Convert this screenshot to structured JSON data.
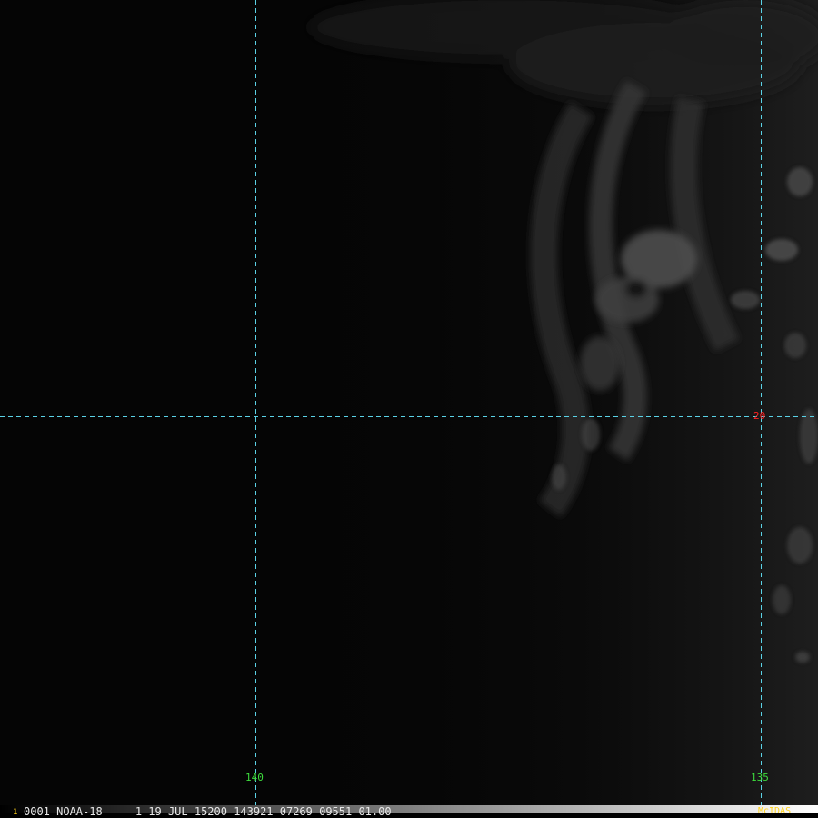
{
  "colors": {
    "grid_line": "#5ad2e6",
    "lon_label": "#3ddc3d",
    "lat_label": "#ff2020",
    "status_text": "#e8e8e8",
    "logo_text": "#ffd21a",
    "frame_number": "#ffd21a"
  },
  "map": {
    "grid": {
      "longitude_labels": [
        "140",
        "135"
      ],
      "latitude_labels": [
        "20"
      ]
    }
  },
  "status_bar": {
    "frame_number": "1",
    "header": "0001 NOAA-18     1 19 JUL 15200 143921 07269 09551 01.00",
    "logo": "McIDAS"
  }
}
